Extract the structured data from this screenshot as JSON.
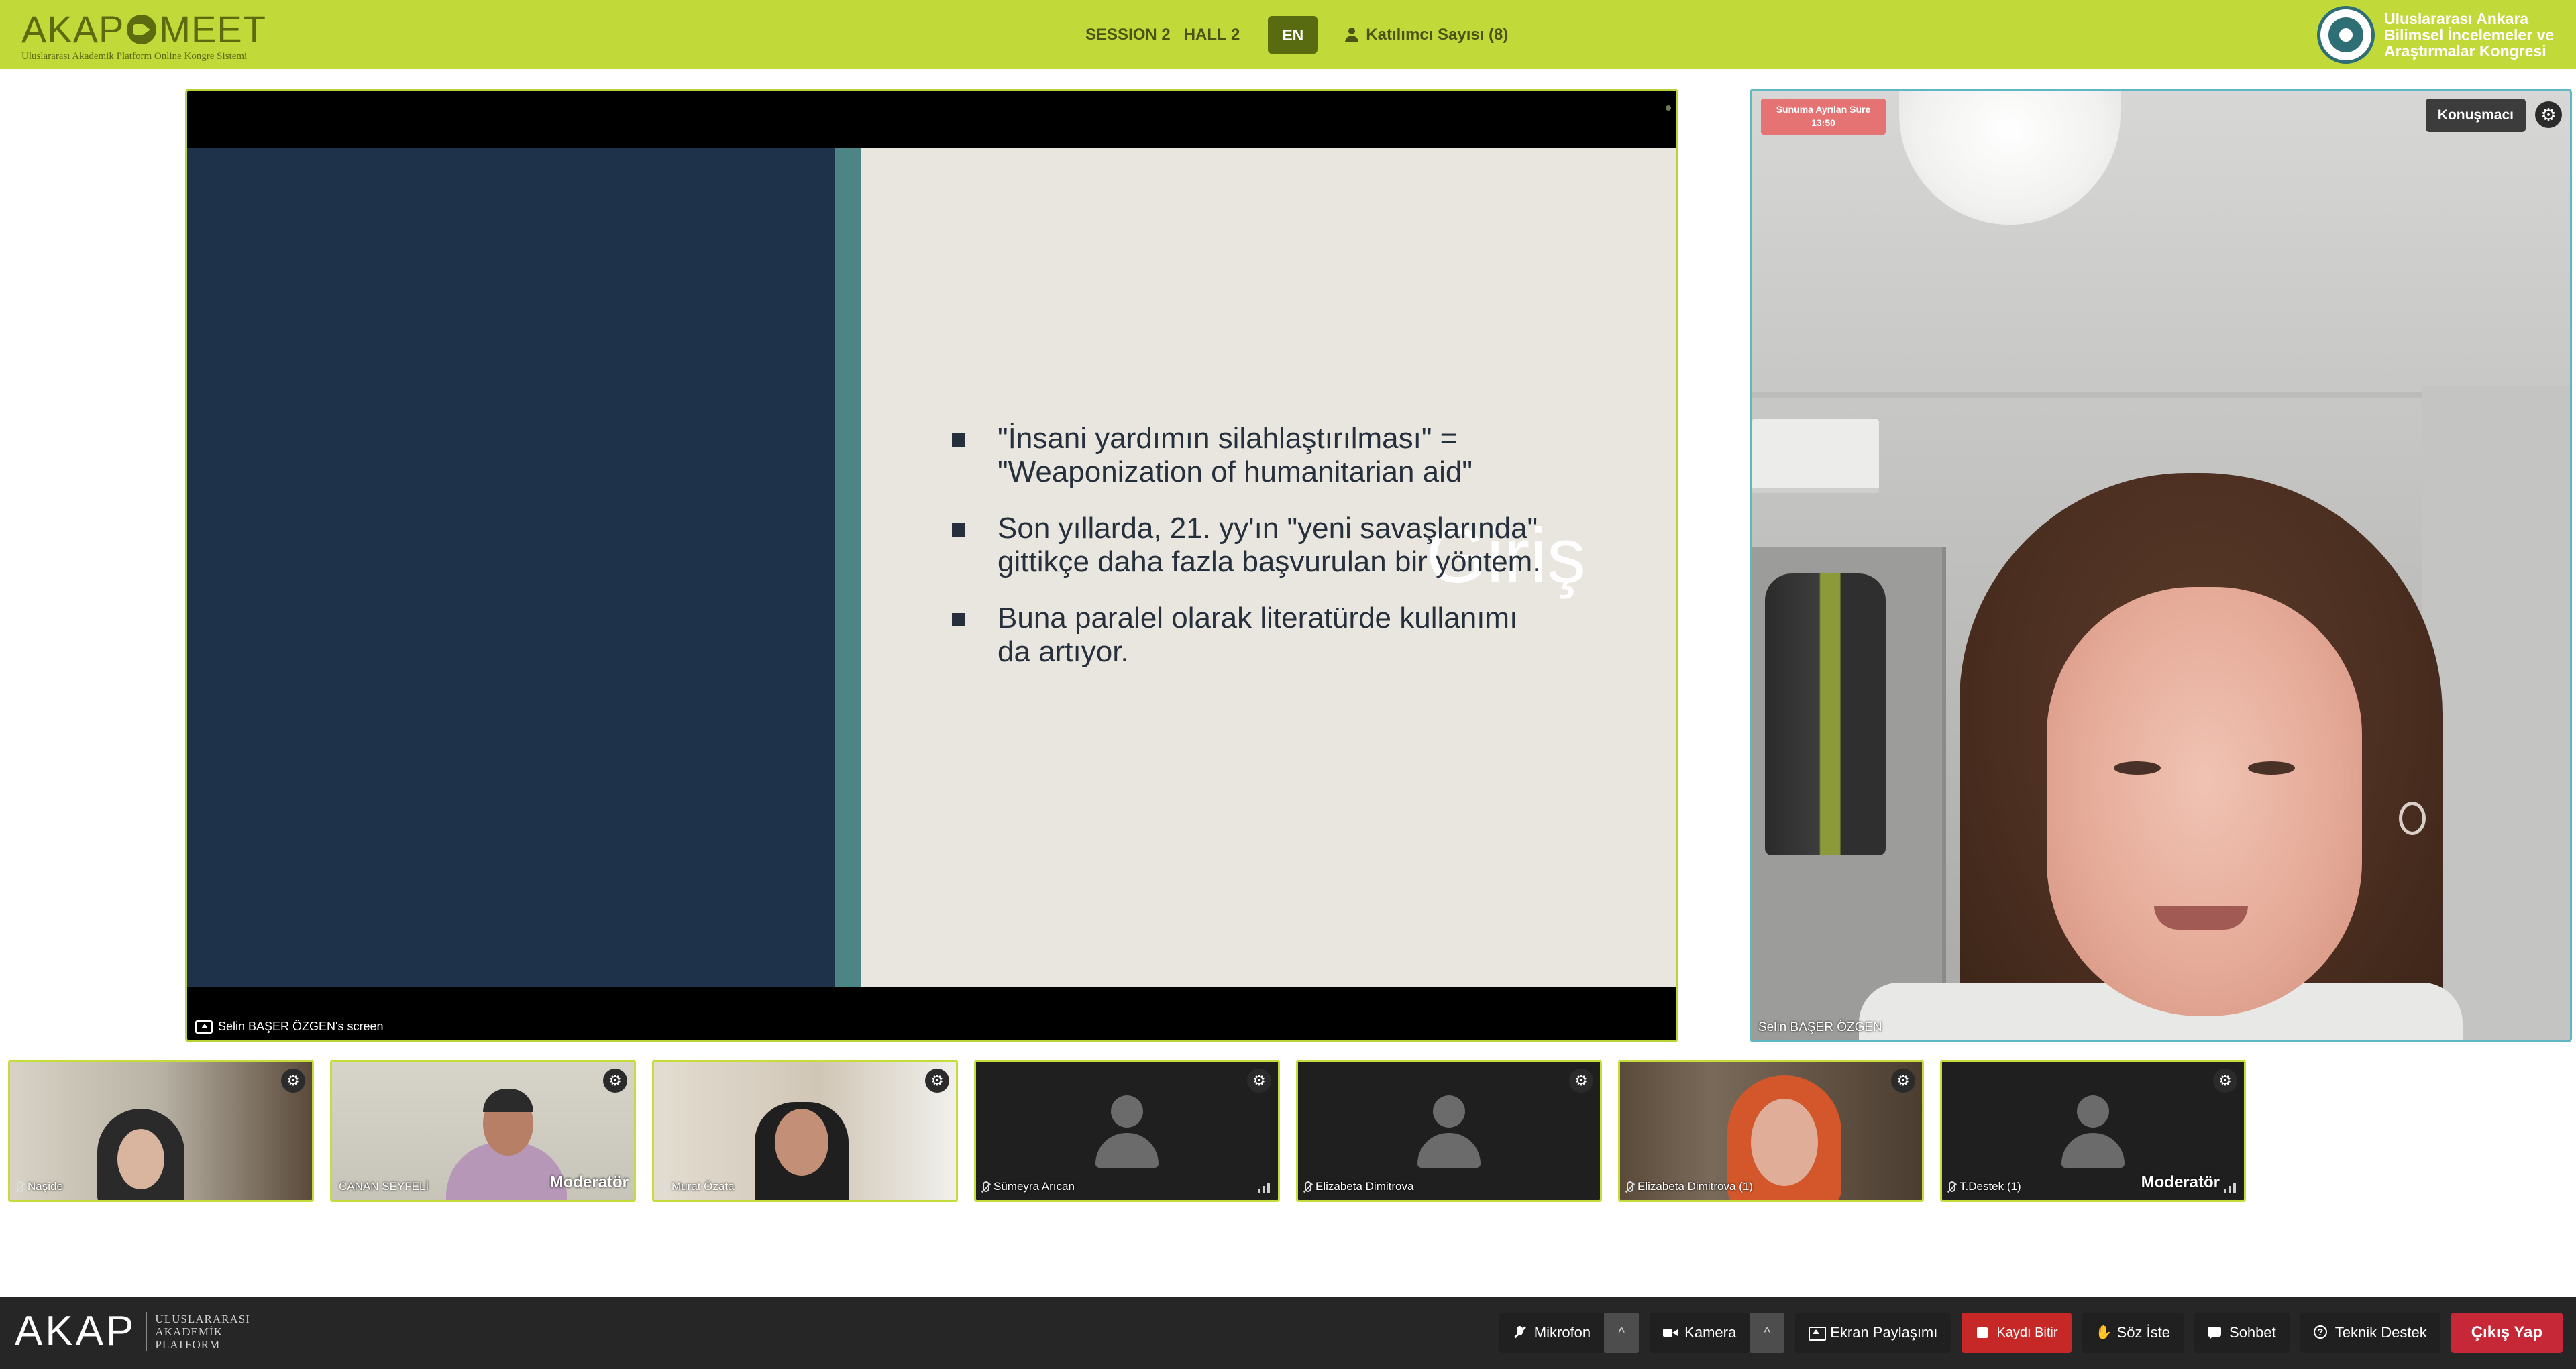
{
  "header": {
    "logo_left": "AKAP",
    "logo_right": "MEET",
    "logo_subtitle": "Uluslararası Akademik Platform Online Kongre Sistemi",
    "session": "SESSION 2",
    "hall": "HALL 2",
    "language_button": "EN",
    "participants_label": "Katılımcı Sayısı (8)",
    "congress_title": "Uluslararası Ankara Bilimsel İncelemeler ve Araştırmalar Kongresi"
  },
  "screen_share": {
    "label": "Selin BAŞER ÖZGEN's screen",
    "slide": {
      "title": "Giriş",
      "bullets": [
        "\"İnsani yardımın silahlaştırılması\" = \"Weaponization of humanitarian aid\"",
        "Son yıllarda, 21. yy'ın \"yeni savaşlarında\" gittikçe daha fazla başvurulan bir yöntem.",
        "Buna paralel olarak literatürde kullanımı da artıyor."
      ]
    }
  },
  "speaker": {
    "timer_label": "Sunuma Ayrılan Süre",
    "timer_value": "13:50",
    "role_badge": "Konuşmacı",
    "name": "Selin BAŞER ÖZGEN"
  },
  "participants": [
    {
      "name": "Naşide",
      "moderator": "",
      "camera": true
    },
    {
      "name": "CANAN SEYFELİ",
      "moderator": "Moderatör",
      "camera": true
    },
    {
      "name": "Murat Özata",
      "moderator": "",
      "camera": true
    },
    {
      "name": "Sümeyra Arıcan",
      "moderator": "",
      "camera": false
    },
    {
      "name": "Elizabeta Dimitrova",
      "moderator": "",
      "camera": false
    },
    {
      "name": "Elizabeta Dimitrova (1)",
      "moderator": "",
      "camera": true
    },
    {
      "name": "T.Destek (1)",
      "moderator": "Moderatör",
      "camera": false
    }
  ],
  "footer": {
    "logo": "AKAP",
    "logo_sub_1": "ULUSLARARASI",
    "logo_sub_2": "AKADEMİK",
    "logo_sub_3": "PLATFORM",
    "microphone": "Mikrofon",
    "camera": "Kamera",
    "screen_share": "Ekran Paylaşımı",
    "stop_recording": "Kaydı Bitir",
    "raise_hand": "Söz İste",
    "chat": "Sohbet",
    "support": "Teknik Destek",
    "exit": "Çıkış Yap",
    "caret": "^"
  }
}
